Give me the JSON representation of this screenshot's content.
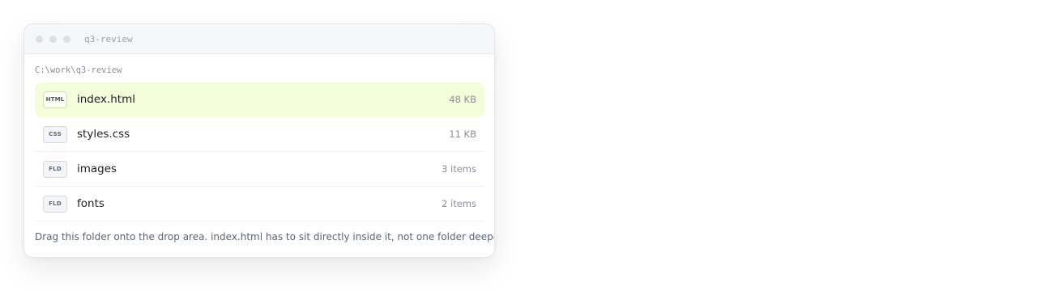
{
  "window": {
    "title": "q3-review",
    "path": "C:\\work\\q3-review"
  },
  "files": [
    {
      "badge": "HTML",
      "name": "index.html",
      "meta": "48 KB",
      "selected": true,
      "icon": "html-file-icon"
    },
    {
      "badge": "CSS",
      "name": "styles.css",
      "meta": "11 KB",
      "selected": false,
      "icon": "css-file-icon"
    },
    {
      "badge": "FLD",
      "name": "images",
      "meta": "3 items",
      "selected": false,
      "icon": "folder-icon"
    },
    {
      "badge": "FLD",
      "name": "fonts",
      "meta": "2 items",
      "selected": false,
      "icon": "folder-icon"
    }
  ],
  "hint": "Drag this folder onto the drop area. index.html has to sit directly inside it, not one folder deeper.",
  "colors": {
    "selected_row": "#f4fdd9",
    "titlebar": "#f6f7f9",
    "window_dot": "#dcdfe3"
  }
}
